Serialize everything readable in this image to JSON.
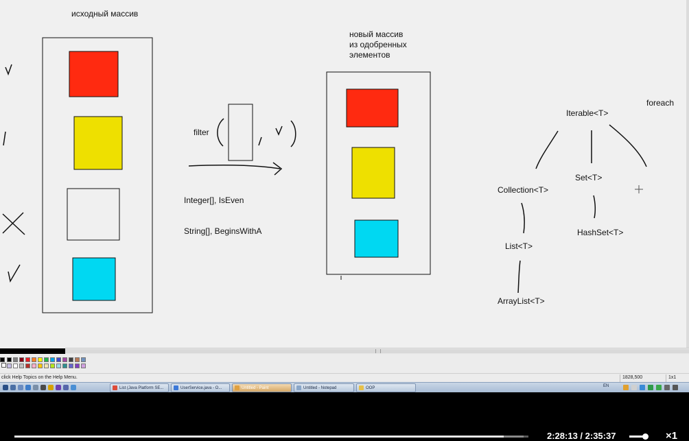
{
  "canvas": {
    "label_source": "исходный массив",
    "label_new": "новый массив\nиз одобренных\nэлементов",
    "label_filter": "filter",
    "label_integer": "Integer[], IsEven",
    "label_string": "String[], BeginsWithA",
    "label_foreach": "foreach",
    "label_iterable": "Iterable<T>",
    "label_collection": "Collection<T>",
    "label_set": "Set<T>",
    "label_list": "List<T>",
    "label_hashset": "HashSet<T>",
    "label_arraylist": "ArrayList<T>",
    "colors": {
      "red": "#ff2a10",
      "yellow": "#eee000",
      "cyan": "#00d8f2",
      "background": "#f0f0f0"
    }
  },
  "palette": {
    "colors": [
      "#000000",
      "#7f7f7f",
      "#880015",
      "#ed1c24",
      "#ff7f27",
      "#fff200",
      "#22b14c",
      "#00a2e8",
      "#3f48cc",
      "#a349a4",
      "#404040",
      "#b97a57",
      "#7092be",
      "#c8bfe7",
      "#ffffff",
      "#c3c3c3",
      "#b5302a",
      "#ffaec9",
      "#ffc90e",
      "#efe4b0",
      "#b5e61d",
      "#99d9ea",
      "#2f8f8f",
      "#6666cc",
      "#8040c0",
      "#d0a0e0"
    ]
  },
  "status": {
    "help_text": "click Help Topics on the Help Menu.",
    "coords": "1828,500",
    "size": "1x1"
  },
  "taskbar": {
    "tasks": [
      {
        "label": "List (Java Platform SE...",
        "icon_color": "#dd4b39",
        "active": false
      },
      {
        "label": "UserService.java - O...",
        "icon_color": "#3c78d8",
        "active": false
      },
      {
        "label": "Untitled - Paint",
        "icon_color": "#e0a040",
        "active": true
      },
      {
        "label": "Untitled - Notepad",
        "icon_color": "#8aa6c8",
        "active": false
      },
      {
        "label": "OOP",
        "icon_color": "#e6c04a",
        "active": false
      }
    ],
    "language": "EN"
  },
  "player": {
    "time": "2:28:13 / 2:35:37",
    "progress": 0.952,
    "buffered": 0.99,
    "volume": 0.9,
    "speed": "×1"
  }
}
